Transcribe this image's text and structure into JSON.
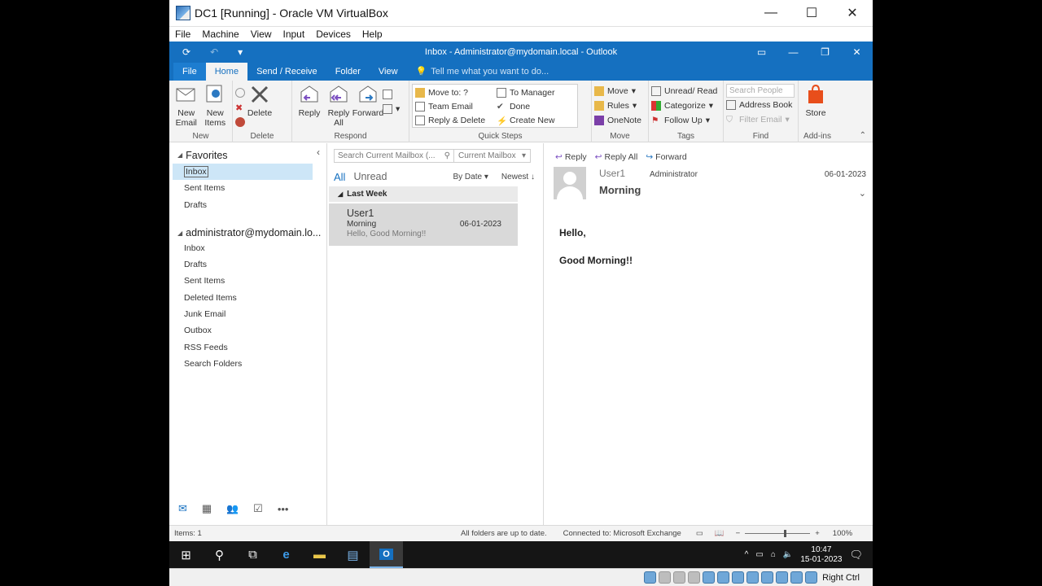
{
  "vbox": {
    "title": "DC1 [Running] - Oracle VM VirtualBox",
    "menu": [
      "File",
      "Machine",
      "View",
      "Input",
      "Devices",
      "Help"
    ],
    "host_key": "Right Ctrl"
  },
  "outlook": {
    "window_title": "Inbox - Administrator@mydomain.local - Outlook",
    "tabs": [
      "File",
      "Home",
      "Send / Receive",
      "Folder",
      "View"
    ],
    "tell_me": "Tell me what you want to do...",
    "ribbon": {
      "new": {
        "new_email": "New Email",
        "new_items": "New Items",
        "label": "New"
      },
      "delete": {
        "delete": "Delete",
        "label": "Delete"
      },
      "respond": {
        "reply": "Reply",
        "reply_all": "Reply All",
        "forward": "Forward",
        "label": "Respond"
      },
      "quick_steps": {
        "items": [
          "Move to: ?",
          "To Manager",
          "Team Email",
          "Done",
          "Reply & Delete",
          "Create New"
        ],
        "label": "Quick Steps"
      },
      "move": {
        "move": "Move",
        "rules": "Rules",
        "onenote": "OneNote",
        "label": "Move"
      },
      "tags": {
        "unread_read": "Unread/ Read",
        "categorize": "Categorize",
        "follow_up": "Follow Up",
        "label": "Tags"
      },
      "find": {
        "search_people": "Search People",
        "address_book": "Address Book",
        "filter_email": "Filter Email",
        "label": "Find"
      },
      "addins": {
        "store": "Store",
        "label": "Add-ins"
      }
    },
    "nav": {
      "favorites_header": "Favorites",
      "favorites": [
        "Inbox",
        "Sent Items",
        "Drafts"
      ],
      "account_header": "administrator@mydomain.lo...",
      "account_folders": [
        "Inbox",
        "Drafts",
        "Sent Items",
        "Deleted Items",
        "Junk Email",
        "Outbox",
        "RSS Feeds",
        "Search Folders"
      ]
    },
    "list": {
      "search_placeholder": "Search Current Mailbox (...",
      "scope": "Current Mailbox",
      "filter_all": "All",
      "filter_unread": "Unread",
      "sort_by": "By Date",
      "sort_order": "Newest",
      "group": "Last Week",
      "message": {
        "from": "User1",
        "subject": "Morning",
        "preview": "Hello,  Good Morning!!",
        "date": "06-01-2023"
      }
    },
    "reading": {
      "actions": [
        "Reply",
        "Reply All",
        "Forward"
      ],
      "sender": "User1",
      "to": "Administrator",
      "subject": "Morning",
      "date": "06-01-2023",
      "body": [
        "Hello,",
        "Good Morning!!"
      ]
    },
    "status": {
      "items": "Items: 1",
      "sync": "All folders are up to date.",
      "connection": "Connected to: Microsoft Exchange",
      "zoom": "100%"
    }
  },
  "taskbar": {
    "time": "10:47",
    "date": "15-01-2023"
  },
  "colors": {
    "accent": "#1570c0",
    "selected": "#cde6f7"
  }
}
